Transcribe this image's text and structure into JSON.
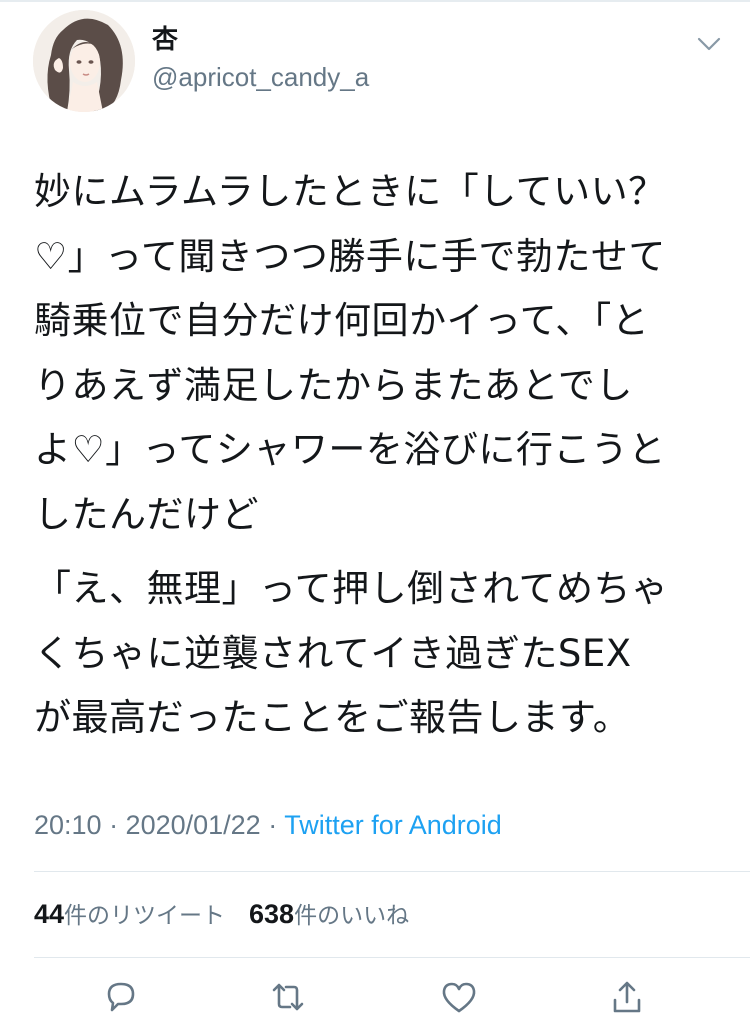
{
  "user": {
    "display_name": "杏",
    "handle": "@apricot_candy_a"
  },
  "tweet": {
    "paragraph1": [
      "妙にムラムラしたときに「していい？",
      "♡」って聞きつつ勝手に手で勃たせて",
      "騎乗位で自分だけ何回かイって、「と",
      "りあえず満足したからまたあとでし",
      "よ♡」ってシャワーを浴びに行こうと",
      "したんだけど"
    ],
    "paragraph2": [
      "「え、無理」って押し倒されてめちゃ",
      "くちゃに逆襲されてイき過ぎたSEX",
      "が最高だったことをご報告します。"
    ]
  },
  "meta": {
    "time": "20:10 · 2020/01/22",
    "separator": " · ",
    "source": "Twitter for Android"
  },
  "stats": {
    "retweet_count": "44",
    "retweet_label": "件のリツイート",
    "like_count": "638",
    "like_label": "件のいいね"
  },
  "icons": {
    "caret": "chevron-down-icon",
    "reply": "reply-icon",
    "retweet": "retweet-icon",
    "like": "heart-icon",
    "share": "share-icon"
  },
  "colors": {
    "text": "#14171a",
    "secondary": "#657786",
    "link": "#1da1f2",
    "divider": "#e1e8ed"
  }
}
